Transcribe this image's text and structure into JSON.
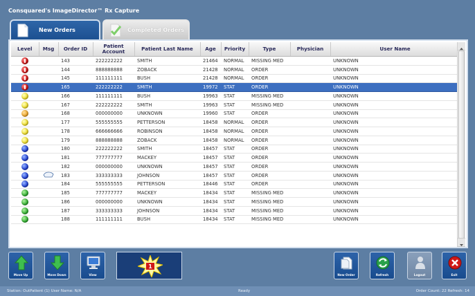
{
  "app": {
    "title": "Consquared's ImageDirector™ Rx Capture"
  },
  "tabs": {
    "new": "New Orders",
    "completed": "Completed Orders"
  },
  "columns": [
    "Level",
    "Msg",
    "Order ID",
    "Patient Account",
    "Patient Last Name",
    "Age",
    "Priority",
    "Type",
    "Physician",
    "User Name"
  ],
  "rows": [
    {
      "level": "red",
      "msg": "",
      "order_id": "143",
      "account": "222222222",
      "last_name": "SMITH",
      "age": "21464",
      "priority": "NORMAL",
      "type": "MISSING MED",
      "physician": "",
      "user": "UNKNOWN"
    },
    {
      "level": "red",
      "msg": "",
      "order_id": "144",
      "account": "888888888",
      "last_name": "ZOBACK",
      "age": "21428",
      "priority": "NORMAL",
      "type": "ORDER",
      "physician": "",
      "user": "UNKNOWN"
    },
    {
      "level": "red",
      "msg": "",
      "order_id": "145",
      "account": "111111111",
      "last_name": "BUSH",
      "age": "21428",
      "priority": "NORMAL",
      "type": "ORDER",
      "physician": "",
      "user": "UNKNOWN"
    },
    {
      "level": "red",
      "msg": "",
      "order_id": "165",
      "account": "222222222",
      "last_name": "SMITH",
      "age": "19972",
      "priority": "STAT",
      "type": "ORDER",
      "physician": "",
      "user": "UNKNOWN",
      "selected": true
    },
    {
      "level": "yellow",
      "msg": "",
      "order_id": "166",
      "account": "111111111",
      "last_name": "BUSH",
      "age": "19963",
      "priority": "STAT",
      "type": "MISSING MED",
      "physician": "",
      "user": "UNKNOWN"
    },
    {
      "level": "yellow",
      "msg": "",
      "order_id": "167",
      "account": "222222222",
      "last_name": "SMITH",
      "age": "19963",
      "priority": "STAT",
      "type": "MISSING MED",
      "physician": "",
      "user": "UNKNOWN"
    },
    {
      "level": "orange",
      "msg": "",
      "order_id": "168",
      "account": "000000000",
      "last_name": "UNKNOWN",
      "age": "19960",
      "priority": "STAT",
      "type": "ORDER",
      "physician": "",
      "user": "UNKNOWN"
    },
    {
      "level": "yellow",
      "msg": "",
      "order_id": "177",
      "account": "555555555",
      "last_name": "PETTERSON",
      "age": "18458",
      "priority": "NORMAL",
      "type": "ORDER",
      "physician": "",
      "user": "UNKNOWN"
    },
    {
      "level": "yellow",
      "msg": "",
      "order_id": "178",
      "account": "666666666",
      "last_name": "ROBINSON",
      "age": "18458",
      "priority": "NORMAL",
      "type": "ORDER",
      "physician": "",
      "user": "UNKNOWN"
    },
    {
      "level": "yellow",
      "msg": "",
      "order_id": "179",
      "account": "888888888",
      "last_name": "ZOBACK",
      "age": "18458",
      "priority": "NORMAL",
      "type": "ORDER",
      "physician": "",
      "user": "UNKNOWN"
    },
    {
      "level": "blue",
      "msg": "",
      "order_id": "180",
      "account": "222222222",
      "last_name": "SMITH",
      "age": "18457",
      "priority": "STAT",
      "type": "ORDER",
      "physician": "",
      "user": "UNKNOWN"
    },
    {
      "level": "blue",
      "msg": "",
      "order_id": "181",
      "account": "777777777",
      "last_name": "MACKEY",
      "age": "18457",
      "priority": "STAT",
      "type": "ORDER",
      "physician": "",
      "user": "UNKNOWN"
    },
    {
      "level": "blue",
      "msg": "",
      "order_id": "182",
      "account": "000000000",
      "last_name": "UNKNOWN",
      "age": "18457",
      "priority": "STAT",
      "type": "ORDER",
      "physician": "",
      "user": "UNKNOWN"
    },
    {
      "level": "blue",
      "msg": "message-icon",
      "order_id": "183",
      "account": "333333333",
      "last_name": "JOHNSON",
      "age": "18457",
      "priority": "STAT",
      "type": "ORDER",
      "physician": "",
      "user": "UNKNOWN"
    },
    {
      "level": "blue",
      "msg": "",
      "order_id": "184",
      "account": "555555555",
      "last_name": "PETTERSON",
      "age": "18446",
      "priority": "STAT",
      "type": "ORDER",
      "physician": "",
      "user": "UNKNOWN"
    },
    {
      "level": "green",
      "msg": "",
      "order_id": "185",
      "account": "777777777",
      "last_name": "MACKEY",
      "age": "18434",
      "priority": "STAT",
      "type": "MISSING MED",
      "physician": "",
      "user": "UNKNOWN"
    },
    {
      "level": "green",
      "msg": "",
      "order_id": "186",
      "account": "000000000",
      "last_name": "UNKNOWN",
      "age": "18434",
      "priority": "STAT",
      "type": "MISSING MED",
      "physician": "",
      "user": "UNKNOWN"
    },
    {
      "level": "green",
      "msg": "",
      "order_id": "187",
      "account": "333333333",
      "last_name": "JOHNSON",
      "age": "18434",
      "priority": "STAT",
      "type": "MISSING MED",
      "physician": "",
      "user": "UNKNOWN"
    },
    {
      "level": "green",
      "msg": "",
      "order_id": "188",
      "account": "111111111",
      "last_name": "BUSH",
      "age": "18434",
      "priority": "STAT",
      "type": "MISSING MED",
      "physician": "",
      "user": "UNKNOWN"
    }
  ],
  "toolbar": {
    "move_up": "Move Up",
    "move_down": "Move Down",
    "view": "View",
    "alert_count": "1",
    "new_order": "New Order",
    "refresh": "Refresh",
    "logout": "Logout",
    "exit": "Exit"
  },
  "status": {
    "left": "Station: OutPatient (1) User Name: N/A",
    "center": "Ready",
    "right": "Order Count: 22  Refresh: 14"
  },
  "colors": {
    "background": "#5d7ea3",
    "tab_active": "#1b4f90",
    "selected_row": "#3d6fc0",
    "exit_red": "#d01818",
    "refresh_green": "#2aa14a"
  }
}
